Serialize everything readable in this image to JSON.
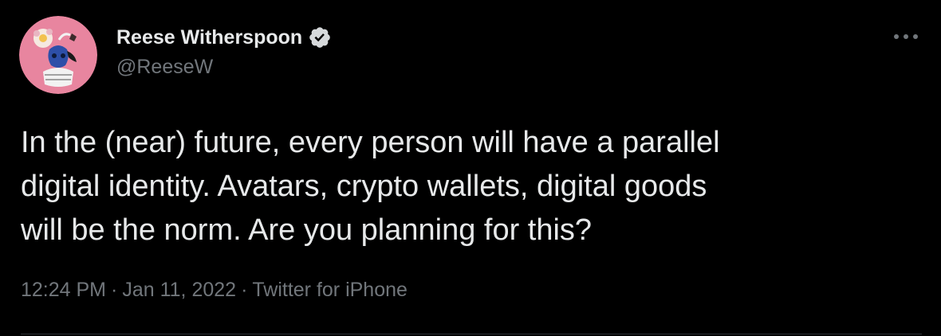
{
  "theme": {
    "background": "#000000",
    "text_primary": "#e7e9ea",
    "text_secondary": "#71767b",
    "verified_badge": "#d6d9db",
    "divider": "#2f3336"
  },
  "author": {
    "display_name": "Reese Witherspoon",
    "handle": "@ReeseW",
    "verified_icon": "verified-badge-icon",
    "avatar_icon": "profile-avatar"
  },
  "tweet": {
    "text_lines": [
      "In the (near) future, every person will have a parallel",
      "digital identity. Avatars, crypto wallets, digital goods",
      "will be the norm. Are you planning for this?"
    ]
  },
  "meta": {
    "time": "12:24 PM",
    "date": "Jan 11, 2022",
    "source": "Twitter for iPhone",
    "separator": "·"
  },
  "actions": {
    "more_icon": "more-options-icon"
  }
}
